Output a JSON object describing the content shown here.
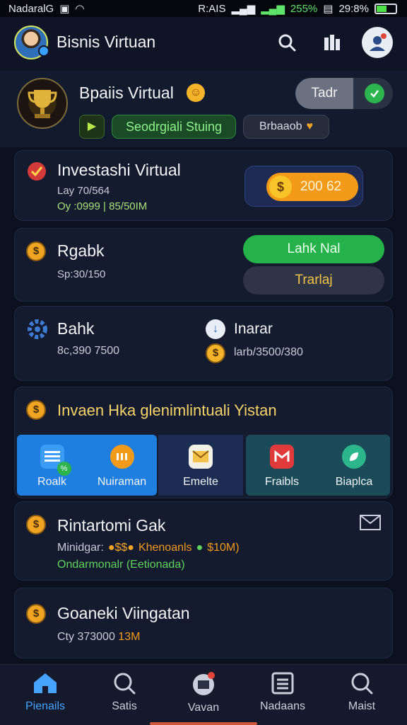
{
  "status_bar": {
    "carrier": "NadaralG",
    "network": "R:AIS",
    "battery_pct": "255%",
    "time": "29:8%"
  },
  "header": {
    "app_title": "Bisnis Virtuan"
  },
  "profile": {
    "name": "Bpaiis Virtual",
    "level_label": "Seodrgiali Stuing",
    "badge_label": "Brbaaob",
    "toggle_label": "Tadr"
  },
  "cards": {
    "investasi": {
      "title": "Investashi Virtual",
      "line1": "Lay 70/564",
      "line2": "Oy :0999 | 85/50IM",
      "balance": "200 62"
    },
    "rgabk": {
      "title": "Rgabk",
      "sub": "Sp:30/150",
      "btn_primary": "Lahk Nal",
      "btn_secondary": "Trarlaj"
    },
    "bank": {
      "left_title": "Bahk",
      "left_sub": "8c,390 7500",
      "right_title": "Inarar",
      "right_sub": "larb/3500/380"
    },
    "invest_list": {
      "title": "Invaen Hka glenimlintuali Yistan",
      "tiles": [
        {
          "label": "Roalk"
        },
        {
          "label": "Nuiraman"
        },
        {
          "label": "Emelte"
        },
        {
          "label": "Fraibls"
        },
        {
          "label": "Biaplca"
        }
      ]
    },
    "rintartomi": {
      "title": "Rintartomi Gak",
      "line1_a": "Minidgar:",
      "line1_b": "Khenoanls",
      "line1_c": "$10M)",
      "line2": "Ondarmonalr (Eetionada)"
    },
    "goaneki": {
      "title": "Goaneki Viingatan",
      "sub_a": "Cty 373000",
      "sub_b": "13M"
    }
  },
  "bottom_nav": [
    {
      "label": "Pienails",
      "active": true
    },
    {
      "label": "Satis",
      "active": false
    },
    {
      "label": "Vavan",
      "active": false
    },
    {
      "label": "Nadaans",
      "active": false
    },
    {
      "label": "Maist",
      "active": false
    }
  ],
  "colors": {
    "accent": "#46a4ff",
    "primary_green": "#25b24a",
    "coin_orange": "#f0a424"
  }
}
